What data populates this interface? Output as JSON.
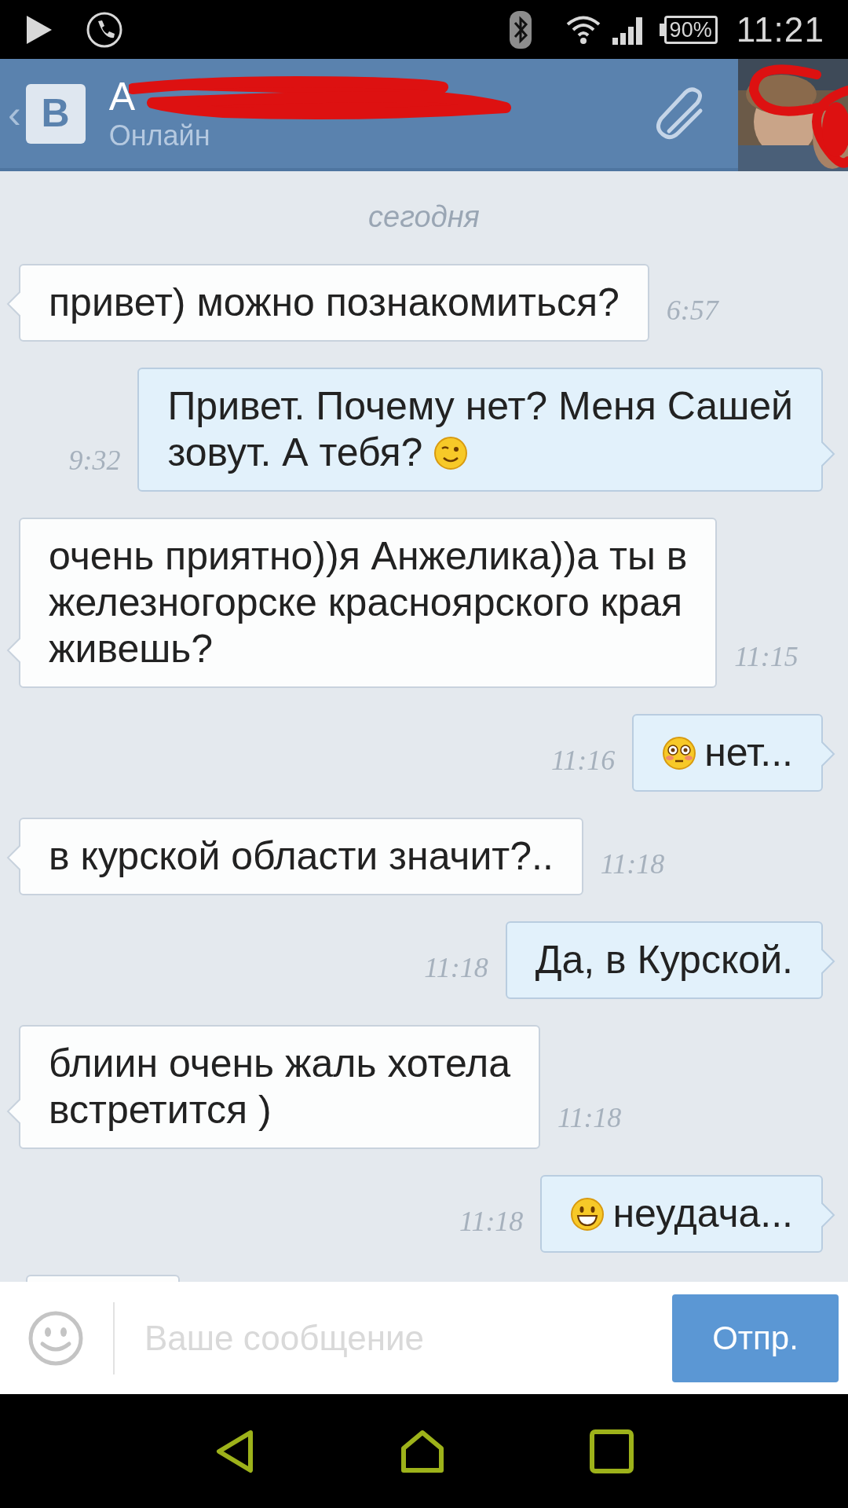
{
  "status_bar": {
    "battery": "90%",
    "time": "11:21"
  },
  "header": {
    "back": "‹",
    "logo": "В",
    "title": "А",
    "subtitle": "Онлайн"
  },
  "date_divider": "сегодня",
  "messages": [
    {
      "kind": "incoming",
      "text": "привет) можно познакомиться?",
      "time": "6:57"
    },
    {
      "kind": "outgoing",
      "text": "Привет. Почему нет? Меня Сашей\nзовут. А тебя?",
      "time": "9:32",
      "emoji": {
        "kind": "wink",
        "first": false
      }
    },
    {
      "kind": "incoming",
      "text": "очень приятно))я Анжелика))а ты в\nжелезногорске красноярского края\nживешь?",
      "time": "11:15"
    },
    {
      "kind": "outgoing",
      "text": "нет...",
      "time": "11:16",
      "emoji": {
        "kind": "flushed",
        "first": true
      }
    },
    {
      "kind": "incoming",
      "text": "в курской области значит?..",
      "time": "11:18"
    },
    {
      "kind": "outgoing",
      "text": "Да, в Курской.",
      "time": "11:18"
    },
    {
      "kind": "incoming",
      "text": "блиин очень жаль хотела\nвстретится )",
      "time": "11:18"
    },
    {
      "kind": "outgoing",
      "text": "неудача...",
      "time": "11:18",
      "emoji": {
        "kind": "grin",
        "first": true
      }
    }
  ],
  "composer": {
    "placeholder": "Ваше сообщение",
    "send_button": "Отпр."
  }
}
